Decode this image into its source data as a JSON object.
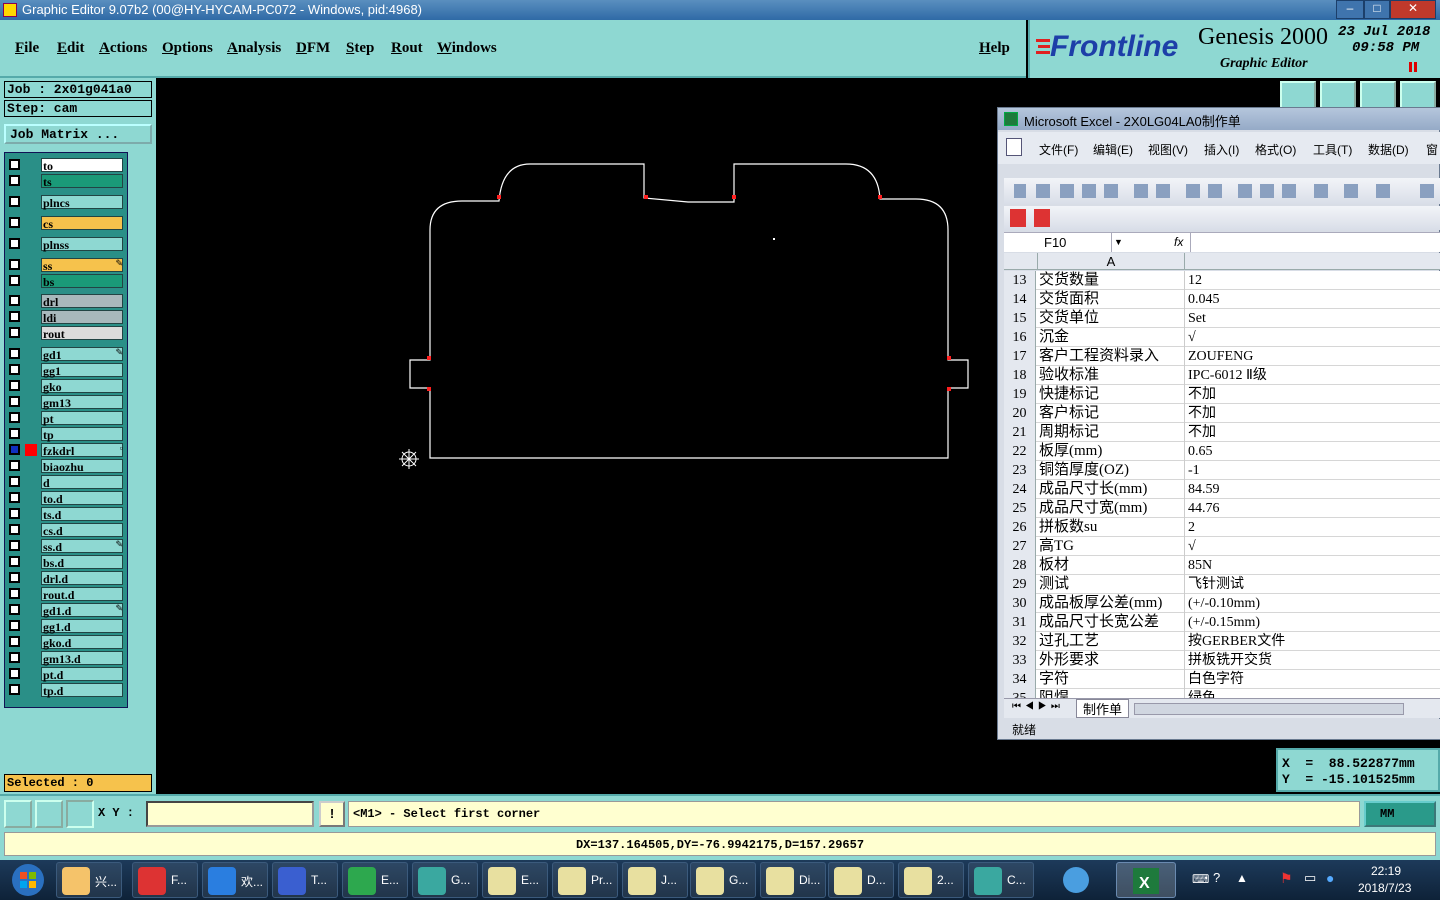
{
  "window": {
    "title": "Graphic Editor 9.07b2 (00@HY-HYCAM-PC072 - Windows, pid:4968)",
    "controls": [
      "–",
      "□",
      "✕"
    ]
  },
  "menu": {
    "items": [
      "File",
      "Edit",
      "Actions",
      "Options",
      "Analysis",
      "DFM",
      "Step",
      "Rout",
      "Windows"
    ],
    "help": "Help"
  },
  "brand": {
    "logo": "Frontline",
    "product": "Genesis 2000",
    "subtitle": "Graphic Editor",
    "date": "23 Jul 2018",
    "time": "09:58 PM"
  },
  "left": {
    "job": "Job : 2x01g041a0",
    "step": "Step: cam",
    "job_matrix": "Job Matrix ...",
    "selected": "Selected : 0",
    "layers": [
      {
        "name": "to",
        "color": "#ffffff"
      },
      {
        "name": "ts",
        "color": "#1a9a78"
      },
      {
        "name": "plncs",
        "color": "#8ed8d2"
      },
      {
        "name": "cs",
        "color": "#f6c24c"
      },
      {
        "name": "plnss",
        "color": "#8ed8d2"
      },
      {
        "name": "ss",
        "color": "#f6c24c",
        "mark": "✎"
      },
      {
        "name": "bs",
        "color": "#1a9a78"
      },
      {
        "name": "drl",
        "color": "#a8b8bc"
      },
      {
        "name": "ldi",
        "color": "#a8b8bc"
      },
      {
        "name": "rout",
        "color": "#dcdcdc"
      },
      {
        "name": "gd1",
        "color": "#8ed8d2",
        "mark": "✎"
      },
      {
        "name": "gg1",
        "color": "#8ed8d2"
      },
      {
        "name": "gko",
        "color": "#8ed8d2"
      },
      {
        "name": "gm13",
        "color": "#8ed8d2"
      },
      {
        "name": "pt",
        "color": "#8ed8d2"
      },
      {
        "name": "tp",
        "color": "#8ed8d2"
      },
      {
        "name": "fzkdrl",
        "color": "#8ed8d2",
        "mark": "▫"
      },
      {
        "name": "biaozhu",
        "color": "#8ed8d2"
      },
      {
        "name": "d",
        "color": "#8ed8d2"
      },
      {
        "name": "to.d",
        "color": "#8ed8d2"
      },
      {
        "name": "ts.d",
        "color": "#8ed8d2"
      },
      {
        "name": "cs.d",
        "color": "#8ed8d2"
      },
      {
        "name": "ss.d",
        "color": "#8ed8d2",
        "mark": "✎"
      },
      {
        "name": "bs.d",
        "color": "#8ed8d2"
      },
      {
        "name": "drl.d",
        "color": "#8ed8d2"
      },
      {
        "name": "rout.d",
        "color": "#8ed8d2"
      },
      {
        "name": "gd1.d",
        "color": "#8ed8d2",
        "mark": "✎"
      },
      {
        "name": "gg1.d",
        "color": "#8ed8d2"
      },
      {
        "name": "gko.d",
        "color": "#8ed8d2"
      },
      {
        "name": "gm13.d",
        "color": "#8ed8d2"
      },
      {
        "name": "pt.d",
        "color": "#8ed8d2"
      },
      {
        "name": "tp.d",
        "color": "#8ed8d2"
      }
    ]
  },
  "excel": {
    "title": "Microsoft Excel - 2X0LG04LA0制作单",
    "menu": [
      "文件(F)",
      "编辑(E)",
      "视图(V)",
      "插入(I)",
      "格式(O)",
      "工具(T)",
      "数据(D)",
      "窗"
    ],
    "namebox": "F10",
    "fx": "fx",
    "col_header": "A",
    "rows": [
      {
        "n": "13",
        "a": "交货数量",
        "b": "12"
      },
      {
        "n": "14",
        "a": "交货面积",
        "b": "0.045"
      },
      {
        "n": "15",
        "a": "交货单位",
        "b": "Set"
      },
      {
        "n": "16",
        "a": "沉金",
        "b": "√"
      },
      {
        "n": "17",
        "a": "客户工程资料录入",
        "b": "ZOUFENG"
      },
      {
        "n": "18",
        "a": "验收标准",
        "b": "IPC-6012 Ⅱ级"
      },
      {
        "n": "19",
        "a": "快捷标记",
        "b": "不加"
      },
      {
        "n": "20",
        "a": "客户标记",
        "b": "不加"
      },
      {
        "n": "21",
        "a": "周期标记",
        "b": "不加"
      },
      {
        "n": "22",
        "a": "板厚(mm)",
        "b": "0.65"
      },
      {
        "n": "23",
        "a": "铜箔厚度(OZ)",
        "b": "-1"
      },
      {
        "n": "24",
        "a": "成品尺寸长(mm)",
        "b": "84.59"
      },
      {
        "n": "25",
        "a": "成品尺寸宽(mm)",
        "b": "44.76"
      },
      {
        "n": "26",
        "a": "拼板数su",
        "b": "2"
      },
      {
        "n": "27",
        "a": "高TG",
        "b": "√"
      },
      {
        "n": "28",
        "a": "板材",
        "b": "85N"
      },
      {
        "n": "29",
        "a": "测试",
        "b": "飞针测试"
      },
      {
        "n": "30",
        "a": "成品板厚公差(mm)",
        "b": "(+/-0.10mm)"
      },
      {
        "n": "31",
        "a": "成品尺寸长宽公差",
        "b": "(+/-0.15mm)"
      },
      {
        "n": "32",
        "a": "过孔工艺",
        "b": "按GERBER文件"
      },
      {
        "n": "33",
        "a": "外形要求",
        "b": "拼板铣开交货"
      },
      {
        "n": "34",
        "a": "字符",
        "b": "白色字符"
      },
      {
        "n": "35",
        "a": "阻焊",
        "b": "绿色"
      }
    ],
    "sheet_tab": "制作单",
    "status": "就绪"
  },
  "coords": {
    "x": "X  =  88.522877mm",
    "y": "Y  = -15.101525mm"
  },
  "cmd": {
    "xy_label": "X Y :",
    "input_value": "",
    "prompt": "<M1> - Select first corner",
    "unit": "MM"
  },
  "status": {
    "measure": "DX=137.164505,DY=-76.9942175,D=157.29657"
  },
  "taskbar": {
    "items": [
      {
        "label": "兴...",
        "color": "#f5c36a"
      },
      {
        "label": "F...",
        "color": "#d33"
      },
      {
        "label": "欢...",
        "color": "#2a7ee0"
      },
      {
        "label": "T...",
        "color": "#3a5fd0"
      },
      {
        "label": "E...",
        "color": "#2da84e"
      },
      {
        "label": "G...",
        "color": "#3aa8a0"
      },
      {
        "label": "E...",
        "color": "#e8e0a0"
      },
      {
        "label": "Pr...",
        "color": "#e8e0a0"
      },
      {
        "label": "J...",
        "color": "#e8e0a0"
      },
      {
        "label": "G...",
        "color": "#e8e0a0"
      },
      {
        "label": "Di...",
        "color": "#e8e0a0"
      },
      {
        "label": "D...",
        "color": "#e8e0a0"
      },
      {
        "label": "2...",
        "color": "#e8e0a0"
      },
      {
        "label": "C...",
        "color": "#3aa8a0"
      }
    ],
    "time": "22:19",
    "date": "2018/7/23"
  }
}
